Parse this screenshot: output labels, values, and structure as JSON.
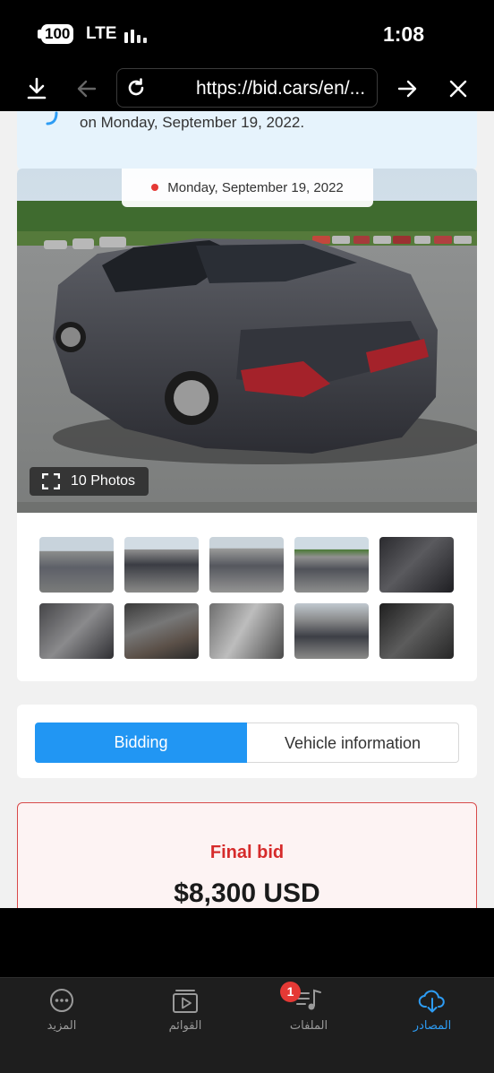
{
  "status_bar": {
    "battery": "100",
    "network": "LTE",
    "time": "1:08"
  },
  "browser": {
    "url": "https://bid.cars/en/..."
  },
  "alert": {
    "text": "on Monday, September 19, 2022."
  },
  "gallery": {
    "date": "Monday, September 19, 2022",
    "photos_button": "10 Photos"
  },
  "tabs": [
    {
      "label": "Bidding",
      "active": true
    },
    {
      "label": "Vehicle information",
      "active": false
    }
  ],
  "bid": {
    "label": "Final bid",
    "value": "$8,300 USD"
  },
  "bottom_nav": {
    "items": [
      {
        "label": "المزيد",
        "icon": "more-icon"
      },
      {
        "label": "القوائم",
        "icon": "playlist-icon"
      },
      {
        "label": "الملفات",
        "icon": "music-files-icon",
        "badge": "1"
      },
      {
        "label": "المصادر",
        "icon": "cloud-download-icon",
        "active": true
      }
    ]
  },
  "colors": {
    "accent": "#2196f3",
    "bid_red": "#d62b2b",
    "nav_active": "#2d9cf4"
  }
}
